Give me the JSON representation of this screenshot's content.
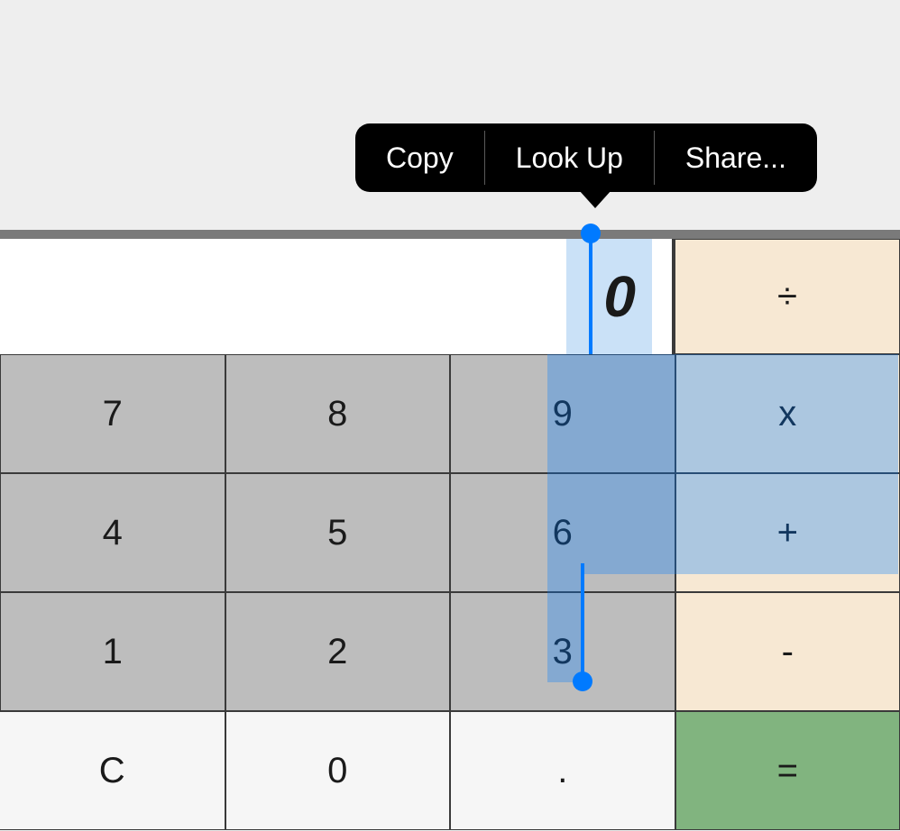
{
  "popover": {
    "copy": "Copy",
    "lookup": "Look Up",
    "share": "Share..."
  },
  "display": {
    "value": "0"
  },
  "keys": {
    "divide": "÷",
    "multiply": "x",
    "plus": "+",
    "minus": "-",
    "equals": "=",
    "clear": "C",
    "dot": ".",
    "n0": "0",
    "n1": "1",
    "n2": "2",
    "n3": "3",
    "n4": "4",
    "n5": "5",
    "n6": "6",
    "n7": "7",
    "n8": "8",
    "n9": "9"
  }
}
